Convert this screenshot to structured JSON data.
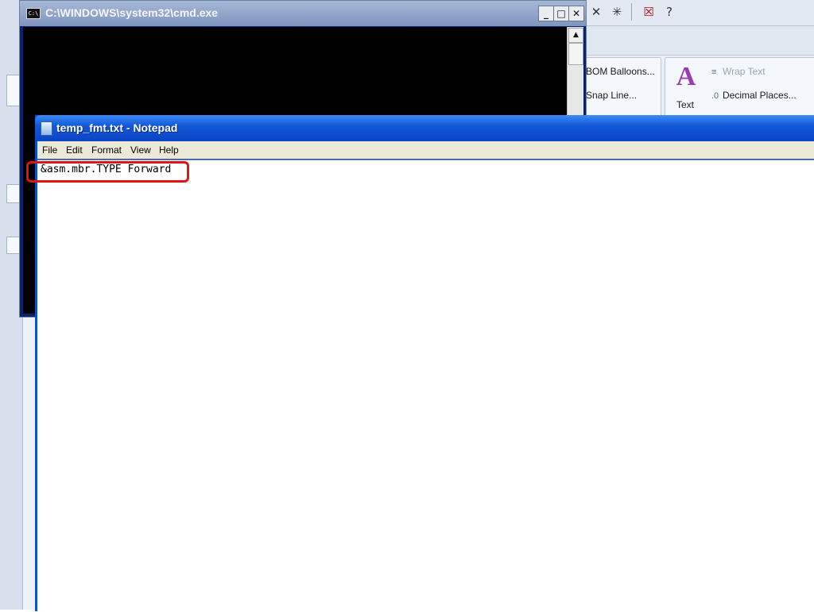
{
  "cmd_window": {
    "title": "C:\\WINDOWS\\system32\\cmd.exe",
    "icon_text": "C:\\"
  },
  "notepad": {
    "title": "temp_fmt.txt - Notepad",
    "menus": [
      "File",
      "Edit",
      "Format",
      "View",
      "Help"
    ],
    "content": "&asm.mbr.TYPE Forward"
  },
  "ribbon": {
    "bom_balloons": "BOM Balloons...",
    "snap_line": "Snap Line...",
    "text_style": "Text",
    "wrap_text": "Wrap Text",
    "decimal_places": "Decimal Places..."
  },
  "colors": {
    "highlight_border": "#e01414",
    "notepad_title_bar": "#1358d9",
    "cmd_background": "#000000"
  }
}
